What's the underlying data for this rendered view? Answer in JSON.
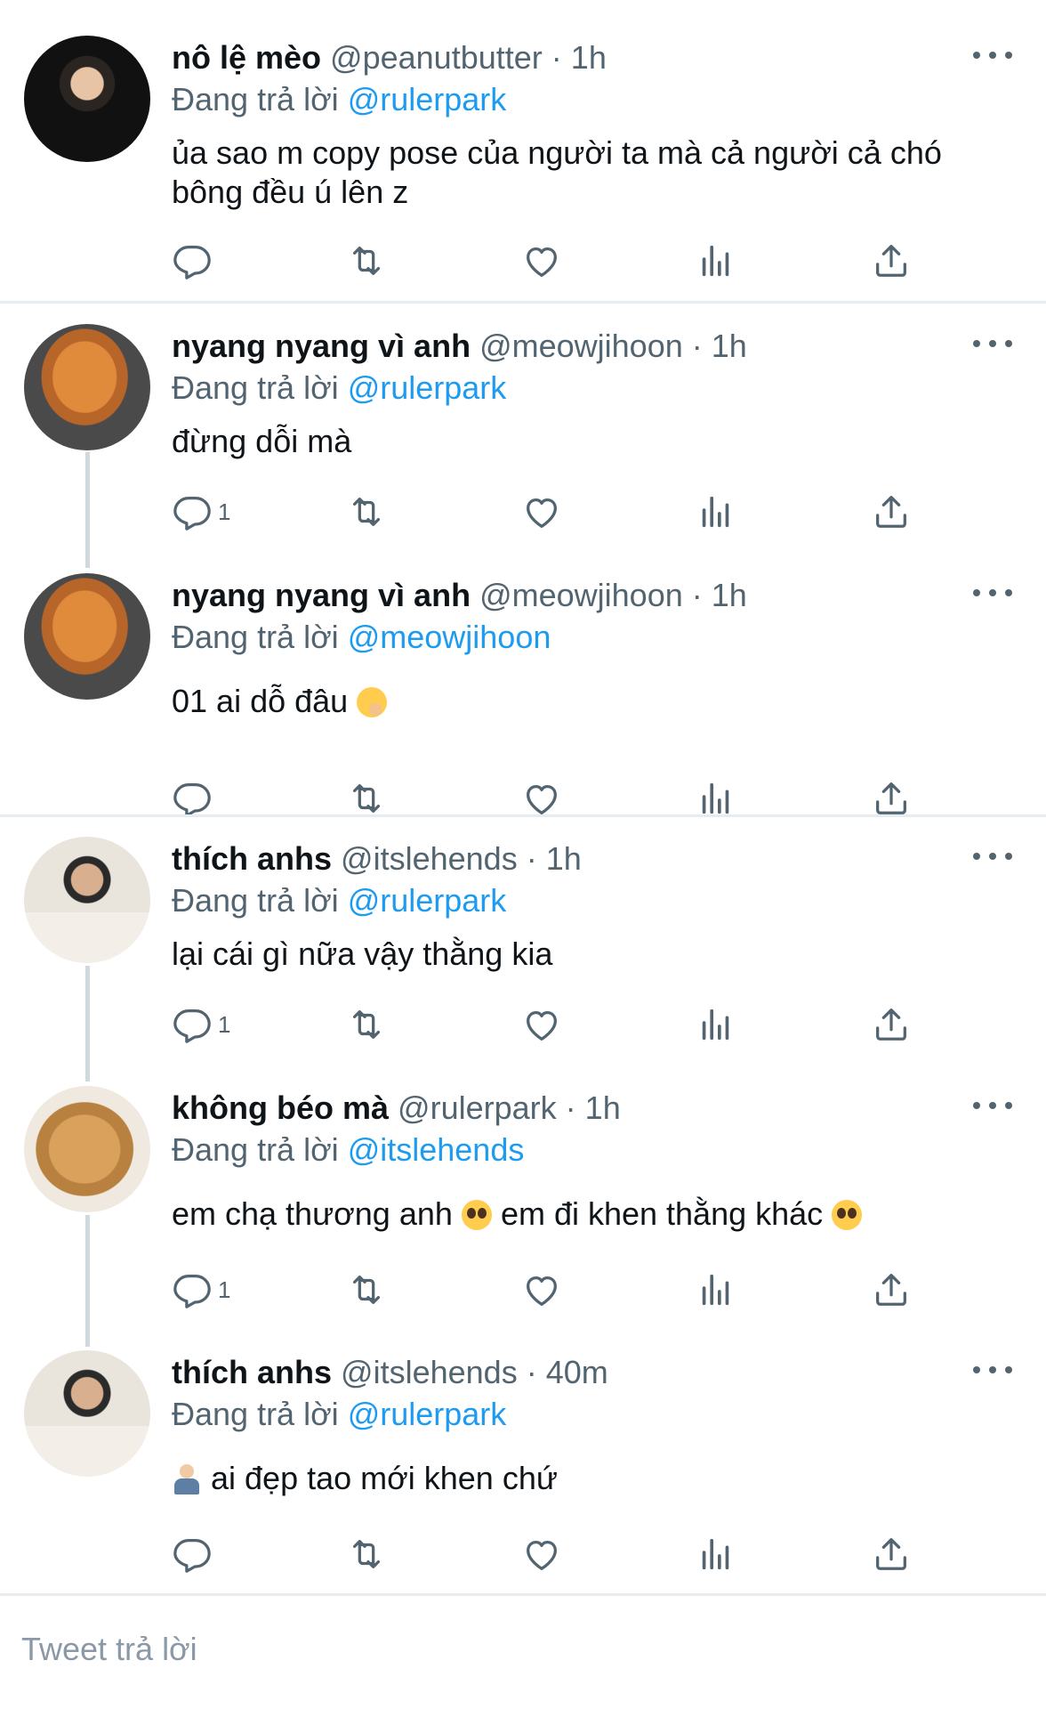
{
  "colors": {
    "accent": "#1d9bf0",
    "muted": "#536471",
    "divider": "#e6ecf0",
    "thread": "#cfd9de"
  },
  "reply_prefix": "Đang trả lời",
  "tweets": [
    {
      "name": "nô lệ mèo",
      "handle": "@peanutbutter",
      "sep": "·",
      "time": "1h",
      "reply_to": "@rulerpark",
      "text": "ủa sao m copy pose của người ta mà cả người cả chó bông đều ú lên z",
      "reply_count": "",
      "avatar": "user-photo-avatar"
    },
    {
      "name": "nyang nyang vì anh",
      "handle": "@meowjihoon",
      "sep": "·",
      "time": "1h",
      "reply_to": "@rulerpark",
      "text": "đừng dỗi mà",
      "reply_count": "1",
      "avatar": "orange-cat-avatar"
    },
    {
      "name": "nyang nyang vì anh",
      "handle": "@meowjihoon",
      "sep": "·",
      "time": "1h",
      "reply_to": "@meowjihoon",
      "text": "01 ai dỗ đâu",
      "emoji": "face-with-hand-over-mouth",
      "reply_count": "",
      "avatar": "orange-cat-avatar"
    },
    {
      "name": "thích anhs",
      "handle": "@itslehends",
      "sep": "·",
      "time": "1h",
      "reply_to": "@rulerpark",
      "text": "lại cái gì nữa vậy thằng kia",
      "reply_count": "1",
      "avatar": "heart-hands-avatar"
    },
    {
      "name": "không béo mà",
      "handle": "@rulerpark",
      "sep": "·",
      "time": "1h",
      "reply_to": "@itslehends",
      "text_a": "em chạ thương anh",
      "text_b": "em đi khen thằng khác",
      "emoji": "pleading-face",
      "reply_count": "1",
      "avatar": "crying-dog-avatar"
    },
    {
      "name": "thích anhs",
      "handle": "@itslehends",
      "sep": "·",
      "time": "40m",
      "reply_to": "@rulerpark",
      "text": "ai đẹp tao mới khen chứ",
      "emoji": "person-shrugging",
      "reply_count": "",
      "avatar": "heart-hands-avatar"
    }
  ],
  "icons": [
    "reply-icon",
    "retweet-icon",
    "like-icon",
    "analytics-icon",
    "share-icon",
    "more-icon"
  ],
  "compose": {
    "placeholder": "Tweet trả lời"
  }
}
